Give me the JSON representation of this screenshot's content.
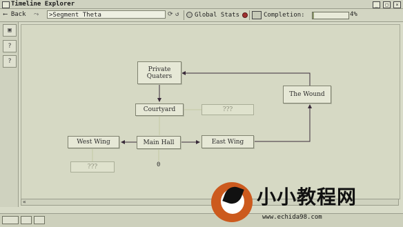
{
  "window": {
    "title": "Timeline Explorer"
  },
  "toolbar": {
    "back_label": "Back",
    "address_value": ">Segment Theta",
    "global_stats_label": "Global Stats",
    "completion_label": "Completion:",
    "completion_fraction": 0.04,
    "completion_text": "4%"
  },
  "nodes": {
    "private_quarters_line1": "Private",
    "private_quarters_line2": "Quaters",
    "courtyard": "Courtyard",
    "unknown_top": "???",
    "the_wound": "The Wound",
    "west_wing": "West Wing",
    "main_hall": "Main Hall",
    "east_wing": "East Wing",
    "unknown_bottom": "???",
    "main_hall_count": "0"
  },
  "watermark": {
    "name": "小小教程网",
    "url": "www.echida98.com"
  },
  "icons": {
    "help": "?",
    "scroll_left": "«"
  },
  "colors": {
    "link_active": "#3a2a3a",
    "link_ghost": "#c4c9a4",
    "watermark_orange": "#cc5a1e"
  }
}
